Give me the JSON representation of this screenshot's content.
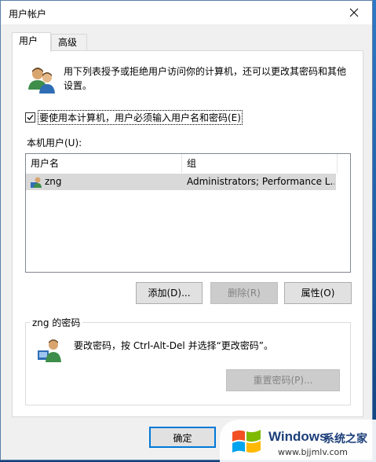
{
  "window": {
    "title": "用户帐户"
  },
  "tabs": [
    {
      "label": "用户"
    },
    {
      "label": "高级"
    }
  ],
  "description": "用下列表授予或拒绝用户访问你的计算机，还可以更改其密码和其他设置。",
  "require_login": {
    "label": "要使用本计算机，用户必须输入用户名和密码(E)",
    "checked": true
  },
  "local_users": {
    "label": "本机用户(U):",
    "columns": [
      "用户名",
      "组"
    ],
    "rows": [
      {
        "name": "zng",
        "group": "Administrators; Performance L..."
      }
    ]
  },
  "buttons": {
    "add": "添加(D)...",
    "remove": "删除(R)",
    "properties": "属性(O)"
  },
  "password_group": {
    "title": "zng 的密码",
    "text": "要改密码，按 Ctrl-Alt-Del 并选择“更改密码”。",
    "reset_button": "重置密码(P)..."
  },
  "footer": {
    "ok": "确定"
  },
  "watermark": {
    "title": "Windows",
    "subtitle": "系统之家",
    "url": "www.bjjmlv.com"
  }
}
